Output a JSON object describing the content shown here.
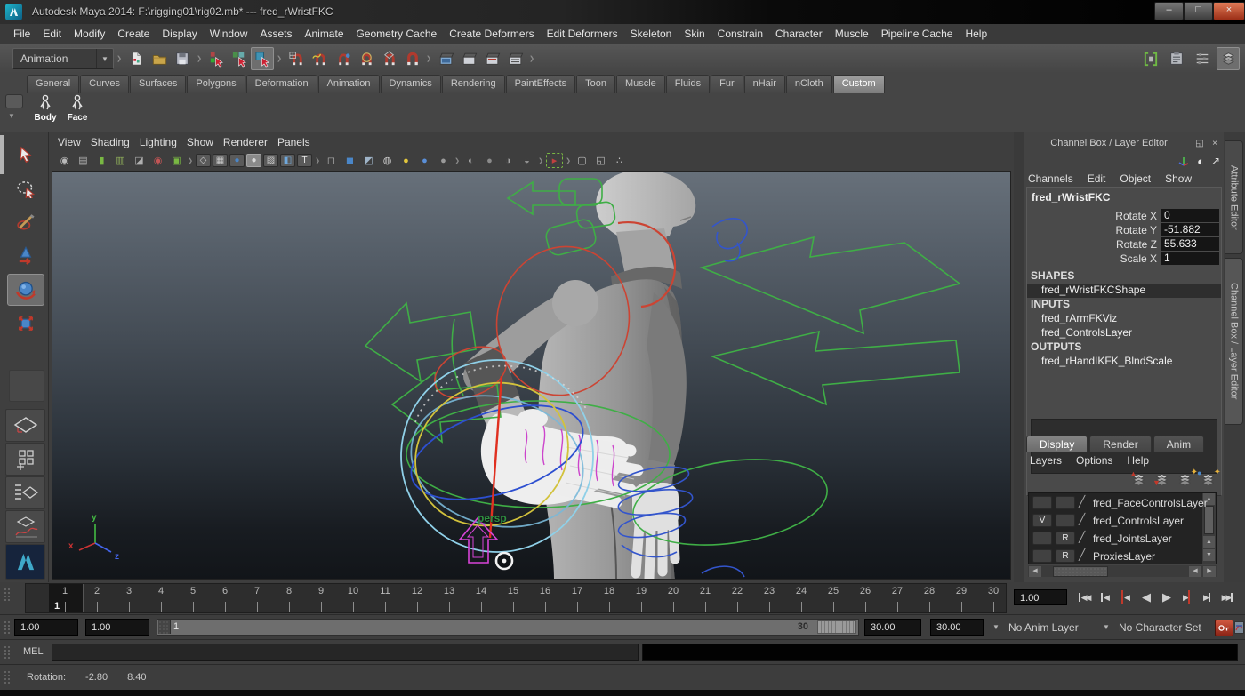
{
  "title_bar": {
    "title": "Autodesk Maya 2014: F:\\rigging01\\rig02.mb*  ---  fred_rWristFKC",
    "window_buttons": [
      {
        "name": "minimize-button",
        "glyph": "–"
      },
      {
        "name": "maximize-button",
        "glyph": "□"
      },
      {
        "name": "close-button",
        "glyph": "×"
      }
    ]
  },
  "menu_bar": [
    "File",
    "Edit",
    "Modify",
    "Create",
    "Display",
    "Window",
    "Assets",
    "Animate",
    "Geometry Cache",
    "Create Deformers",
    "Edit Deformers",
    "Skeleton",
    "Skin",
    "Constrain",
    "Character",
    "Muscle",
    "Pipeline Cache",
    "Help"
  ],
  "status_line": {
    "menuset": "Animation",
    "groups": [
      {
        "icons": [
          {
            "name": "new-scene-icon",
            "kind": "page"
          },
          {
            "name": "open-scene-icon",
            "kind": "folder"
          },
          {
            "name": "save-scene-icon",
            "kind": "floppy"
          }
        ]
      },
      {
        "icons": [
          {
            "name": "select-by-hierarchy-icon",
            "kind": "sel-hier"
          },
          {
            "name": "select-by-object-icon",
            "kind": "sel-obj"
          },
          {
            "name": "select-by-component-icon",
            "kind": "sel-comp",
            "active": true
          }
        ]
      },
      {
        "icons": [
          {
            "name": "snap-to-grid-icon",
            "kind": "magnet-grid"
          },
          {
            "name": "snap-to-curve-icon",
            "kind": "magnet-curve"
          },
          {
            "name": "snap-to-point-icon",
            "kind": "magnet-point"
          },
          {
            "name": "snap-to-projected-center-icon",
            "kind": "magnet-center"
          },
          {
            "name": "snap-to-view-plane-icon",
            "kind": "magnet-plane"
          },
          {
            "name": "make-live-icon",
            "kind": "magnet"
          }
        ]
      },
      {
        "icons": [
          {
            "name": "render-view-icon",
            "kind": "clapper-view"
          },
          {
            "name": "render-current-frame-icon",
            "kind": "clapper"
          },
          {
            "name": "ipr-render-icon",
            "kind": "clapper-ipr"
          },
          {
            "name": "render-settings-icon",
            "kind": "clapper-settings"
          }
        ]
      }
    ],
    "right_icons": [
      {
        "name": "show-attribute-editor-icon",
        "kind": "brackets"
      },
      {
        "name": "show-tool-settings-icon",
        "kind": "clipboard"
      },
      {
        "name": "show-channel-box-icon",
        "kind": "sliders"
      },
      {
        "name": "sidebar-toggle-icon",
        "kind": "stack",
        "active": true
      }
    ]
  },
  "shelf": {
    "tabs": [
      "General",
      "Curves",
      "Surfaces",
      "Polygons",
      "Deformation",
      "Animation",
      "Dynamics",
      "Rendering",
      "PaintEffects",
      "Toon",
      "Muscle",
      "Fluids",
      "Fur",
      "nHair",
      "nCloth",
      "Custom"
    ],
    "active_tab": "Custom",
    "items": [
      {
        "label": "Body",
        "icon": "character-body-icon"
      },
      {
        "label": "Face",
        "icon": "character-face-icon"
      }
    ]
  },
  "toolbox": {
    "tools": [
      {
        "name": "select-tool",
        "kind": "cursor"
      },
      {
        "name": "lasso-tool",
        "kind": "lasso"
      },
      {
        "name": "paint-select-tool",
        "kind": "brush"
      },
      {
        "name": "move-tool",
        "kind": "move"
      },
      {
        "name": "rotate-tool",
        "kind": "rotate",
        "active": true
      },
      {
        "name": "scale-tool",
        "kind": "scale"
      }
    ],
    "layouts": [
      {
        "name": "single-pane-layout-button",
        "kind": "lay1"
      },
      {
        "name": "four-pane-layout-button",
        "kind": "lay4"
      },
      {
        "name": "outliner-persp-layout-button",
        "kind": "laysplit"
      },
      {
        "name": "graph-persp-layout-button",
        "kind": "laygraph"
      }
    ]
  },
  "viewport": {
    "menus": [
      "View",
      "Shading",
      "Lighting",
      "Show",
      "Renderer",
      "Panels"
    ],
    "camera_label": "persp",
    "icons": [
      {
        "name": "selected-camera-icon",
        "glyph": "◉",
        "color": "#b9b9b9"
      },
      {
        "name": "camera-attributes-icon",
        "glyph": "▤",
        "color": "#b0b0b0"
      },
      {
        "name": "bookmarks-icon",
        "glyph": "▮",
        "color": "#79b843"
      },
      {
        "name": "image-plane-icon",
        "glyph": "▥",
        "color": "#8fae5a"
      },
      {
        "name": "two-sided-lighting-icon",
        "glyph": "◪",
        "color": "#b0b0b0"
      },
      {
        "name": "frame-selected-icon",
        "glyph": "◉",
        "color": "#c25555"
      },
      {
        "name": "isolate-select-icon",
        "glyph": "▣",
        "color": "#79b843"
      },
      {
        "sep": true
      },
      {
        "name": "wireframe-icon",
        "glyph": "◇",
        "color": "#cccccc",
        "boxed": true
      },
      {
        "name": "flat-shade-icon",
        "glyph": "▦",
        "color": "#cccccc",
        "boxed": true
      },
      {
        "name": "smooth-shade-icon",
        "glyph": "●",
        "color": "#4a86c8",
        "boxed": true
      },
      {
        "name": "default-shade-icon",
        "glyph": "●",
        "color": "#d8d8d8",
        "boxed": true,
        "active": true
      },
      {
        "name": "xray-icon",
        "glyph": "▨",
        "color": "#cccccc",
        "boxed": true
      },
      {
        "name": "wireframe-on-shaded-icon",
        "glyph": "◧",
        "color": "#6fa8dc",
        "boxed": true
      },
      {
        "name": "textured-icon",
        "glyph": "T",
        "color": "#e8e8e8",
        "boxed": true
      },
      {
        "sep": true
      },
      {
        "name": "default-material-icon",
        "glyph": "◻",
        "color": "#c0c0c0"
      },
      {
        "name": "shaded-cube-icon",
        "glyph": "◼",
        "color": "#4a86c8"
      },
      {
        "name": "textured-cube-icon",
        "glyph": "◩",
        "color": "#9fb4c8"
      },
      {
        "name": "use-all-lights-icon",
        "glyph": "◍",
        "color": "#d0d0d0"
      },
      {
        "name": "key-light-icon",
        "glyph": "●",
        "color": "#e3c73c"
      },
      {
        "name": "fill-light-icon",
        "glyph": "●",
        "color": "#5a8fd8"
      },
      {
        "name": "no-lights-icon",
        "glyph": "●",
        "color": "#9a9a9a"
      },
      {
        "sep": true
      },
      {
        "name": "shadows-icon",
        "glyph": "◐",
        "color": "#b5b5b5"
      },
      {
        "name": "ambient-occlusion-icon",
        "glyph": "●",
        "color": "#8a8a8a"
      },
      {
        "name": "motion-blur-icon",
        "glyph": "◑",
        "color": "#a5a5a5"
      },
      {
        "name": "multisampling-icon",
        "glyph": "◒",
        "color": "#909090"
      },
      {
        "sep": true
      },
      {
        "name": "object-highlighting-icon",
        "glyph": "▸",
        "color": "#c04040",
        "dashed": true
      },
      {
        "sep": true
      },
      {
        "name": "isolate-view-icon",
        "glyph": "▢",
        "color": "#c0c0c0"
      },
      {
        "name": "tear-off-copy-icon",
        "glyph": "◱",
        "color": "#c0c0c0"
      },
      {
        "name": "share-view-icon",
        "glyph": "∴",
        "color": "#c0c0c0"
      }
    ]
  },
  "channel_box": {
    "title": "Channel Box / Layer Editor",
    "header_icons": [
      "dock-icon",
      "close-icon"
    ],
    "option_icons": [
      "manipulator-axis-icon",
      "speed-state-icon",
      "channel-mode-arrow-icon"
    ],
    "menus": [
      "Channels",
      "Edit",
      "Object",
      "Show"
    ],
    "object_name": "fred_rWristFKC",
    "attributes": [
      {
        "label": "Rotate X",
        "value": "0"
      },
      {
        "label": "Rotate Y",
        "value": "-51.882"
      },
      {
        "label": "Rotate Z",
        "value": "55.633"
      },
      {
        "label": "Scale X",
        "value": "1"
      }
    ],
    "sections": [
      {
        "header": "SHAPES",
        "items": [
          {
            "name": "fred_rWristFKCShape",
            "selected": true
          }
        ]
      },
      {
        "header": "INPUTS",
        "items": [
          {
            "name": "fred_rArmFKViz"
          },
          {
            "name": "fred_ControlsLayer"
          }
        ]
      },
      {
        "header": "OUTPUTS",
        "items": [
          {
            "name": "fred_rHandIKFK_BlndScale"
          }
        ]
      }
    ]
  },
  "layer_editor": {
    "tabs": [
      "Display",
      "Render",
      "Anim"
    ],
    "active_tab": "Display",
    "menus": [
      "Layers",
      "Options",
      "Help"
    ],
    "icons": [
      "move-layer-up-icon",
      "move-layer-down-icon",
      "new-empty-layer-icon",
      "new-layer-from-selected-icon"
    ],
    "layers": [
      {
        "visibility": "",
        "display_type": "",
        "name": "fred_FaceControlsLayer"
      },
      {
        "visibility": "V",
        "display_type": "",
        "name": "fred_ControlsLayer"
      },
      {
        "visibility": "",
        "display_type": "R",
        "name": "fred_JointsLayer"
      },
      {
        "visibility": "",
        "display_type": "R",
        "name": "ProxiesLayer"
      }
    ]
  },
  "side_tabs": [
    "Attribute Editor",
    "Channel Box / Layer Editor"
  ],
  "time_slider": {
    "first_frame": 1,
    "last_frame": 30,
    "current_frame": "1",
    "current_time": "1.00",
    "playback_buttons": [
      {
        "name": "go-to-start-button",
        "bars": "left",
        "glyph": "◀◀"
      },
      {
        "name": "step-back-frame-button",
        "bars": "left",
        "glyph": "◀"
      },
      {
        "name": "step-back-key-button",
        "bars": "left-red",
        "glyph": "◀"
      },
      {
        "name": "play-backward-button",
        "glyph": "◀",
        "cls": "playb"
      },
      {
        "name": "play-forward-button",
        "glyph": "▶",
        "cls": "playf"
      },
      {
        "name": "step-forward-key-button",
        "bars": "right-red",
        "glyph": "▶"
      },
      {
        "name": "step-forward-frame-button",
        "bars": "right",
        "glyph": "▶"
      },
      {
        "name": "go-to-end-button",
        "bars": "right",
        "glyph": "▶▶"
      }
    ]
  },
  "range_slider": {
    "animation_start": "1.00",
    "playback_start": "1.00",
    "slider_start": "1",
    "slider_end": "30",
    "playback_end": "30.00",
    "animation_end": "30.00",
    "anim_layer": "No Anim Layer",
    "character_set": "No Character Set"
  },
  "command_line": {
    "label": "MEL"
  },
  "help_line": {
    "label": "Rotation:",
    "value_x": "-2.80",
    "value_y": "8.40"
  },
  "colors": {
    "rig_green": "#3fae46",
    "rig_red": "#cc4433",
    "rig_blue": "#3355cc",
    "rig_magenta": "#cc44cc",
    "manipulator_cyan": "#8fd0e8",
    "autokey_red": "#8c2416",
    "viewport_top": "#67707a",
    "viewport_bottom": "#121519"
  }
}
